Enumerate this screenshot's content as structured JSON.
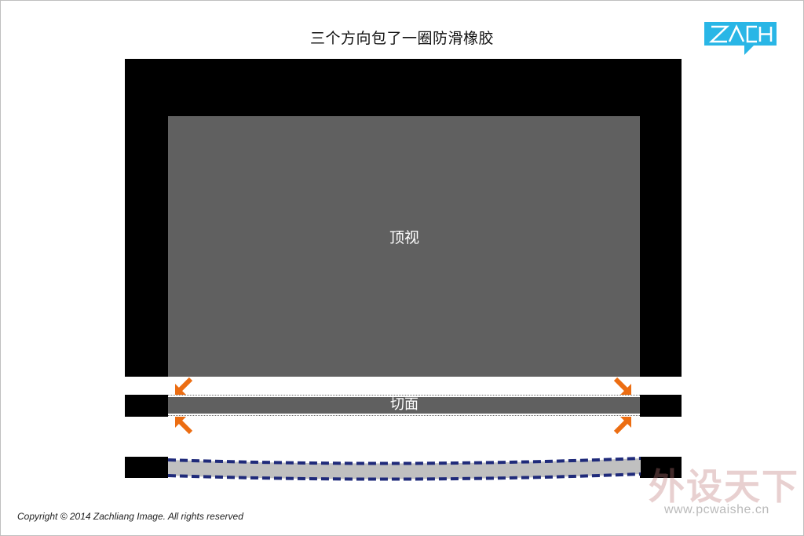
{
  "title": "三个方向包了一圈防滑橡胶",
  "logo": {
    "text": "ZACH",
    "icon": "zach-logo",
    "color": "#29b6e6"
  },
  "labels": {
    "top_view": "顶视",
    "section": "切面"
  },
  "copyright": "Copyright © 2014 Zachliang Image. All rights reserved",
  "watermark": {
    "text": "外设天下",
    "url": "www.pcwaishe.cn"
  },
  "colors": {
    "rubber": "#000000",
    "body": "#606060",
    "arrow": "#ec6d12",
    "curve_dash": "#1f2a7a",
    "curve_fill": "#c0c0c0"
  }
}
